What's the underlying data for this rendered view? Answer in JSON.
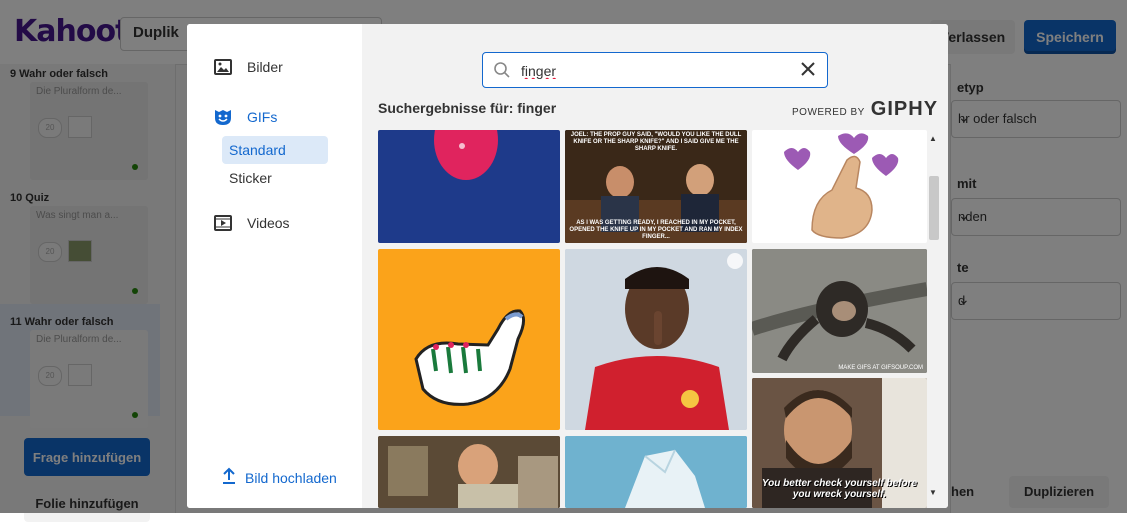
{
  "app": {
    "logo": "Kahoot!",
    "title_field": "Duplik",
    "exit_label": "Verlassen",
    "save_label": "Speichern",
    "colors": {
      "brand": "#46178f",
      "primary": "#1368ce",
      "success": "#26890c"
    }
  },
  "sidebar": {
    "slides": [
      {
        "title": "9  Wahr oder falsch",
        "subtitle": "Die Pluralform de...",
        "timer": "20"
      },
      {
        "title": "10  Quiz",
        "subtitle": "Was singt man a...",
        "timer": "20"
      },
      {
        "title": "11  Wahr oder falsch",
        "subtitle": "Die Pluralform de...",
        "timer": "20"
      }
    ],
    "add_question": "Frage hinzufügen",
    "add_slide": "Folie hinzufügen"
  },
  "right_panel": {
    "label1": "etyp",
    "select1": "hr oder falsch",
    "label2": "mit",
    "select2": "nden",
    "label3": "te",
    "select3": "d",
    "btn1": "hen",
    "btn2": "Duplizieren"
  },
  "modal": {
    "nav": {
      "images": "Bilder",
      "gifs": "GIFs",
      "standard": "Standard",
      "sticker": "Sticker",
      "videos": "Videos",
      "upload": "Bild hochladen"
    },
    "search": {
      "value": "finger",
      "placeholder": ""
    },
    "results_heading": "Suchergebnisse für: finger",
    "powered_by": "POWERED BY",
    "giphy": "GIPHY",
    "gifs": [
      {
        "name": "gif-red-hand"
      },
      {
        "name": "gif-talk-show",
        "caption_top": "JOEL: THE PROP GUY SAID, \"WOULD YOU LIKE THE DULL KNIFE OR THE SHARP KNIFE?\" AND I SAID GIVE ME THE SHARP KNIFE.",
        "caption_bottom": "AS I WAS GETTING READY, I REACHED IN MY POCKET, OPENED THE KNIFE UP IN MY POCKET AND RAN MY INDEX FINGER..."
      },
      {
        "name": "gif-finger-heart"
      },
      {
        "name": "gif-hand-sign"
      },
      {
        "name": "gif-footballer-shush"
      },
      {
        "name": "gif-chimp",
        "watermark": "MAKE GIFS AT GIFSOUP.COM"
      },
      {
        "name": "gif-bedroom"
      },
      {
        "name": "gif-ice"
      },
      {
        "name": "gif-bearded-man",
        "caption": "You better check yourself before you wreck yourself."
      }
    ]
  }
}
